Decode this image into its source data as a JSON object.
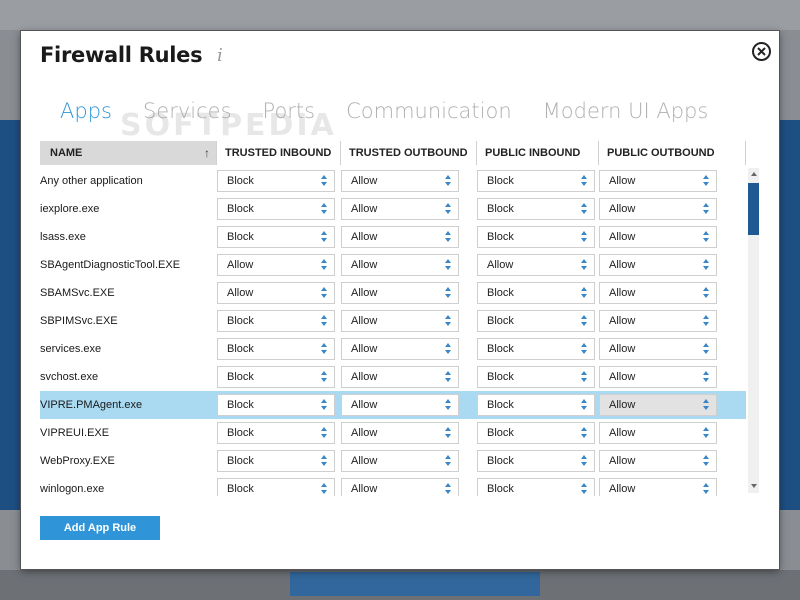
{
  "dialog": {
    "title": "Firewall Rules",
    "info_icon": "i"
  },
  "tabs": [
    {
      "label": "Apps",
      "active": true
    },
    {
      "label": "Services",
      "active": false
    },
    {
      "label": "Ports",
      "active": false
    },
    {
      "label": "Communication",
      "active": false
    },
    {
      "label": "Modern UI Apps",
      "active": false
    }
  ],
  "table": {
    "columns": [
      "NAME",
      "TRUSTED INBOUND",
      "TRUSTED OUTBOUND",
      "PUBLIC INBOUND",
      "PUBLIC OUTBOUND"
    ],
    "rows": [
      {
        "name": "Any other application",
        "values": [
          "Block",
          "Allow",
          "Block",
          "Allow"
        ]
      },
      {
        "name": "iexplore.exe",
        "values": [
          "Block",
          "Allow",
          "Block",
          "Allow"
        ]
      },
      {
        "name": "lsass.exe",
        "values": [
          "Block",
          "Allow",
          "Block",
          "Allow"
        ]
      },
      {
        "name": "SBAgentDiagnosticTool.EXE",
        "values": [
          "Allow",
          "Allow",
          "Allow",
          "Allow"
        ]
      },
      {
        "name": "SBAMSvc.EXE",
        "values": [
          "Allow",
          "Allow",
          "Block",
          "Allow"
        ]
      },
      {
        "name": "SBPIMSvc.EXE",
        "values": [
          "Block",
          "Allow",
          "Block",
          "Allow"
        ]
      },
      {
        "name": "services.exe",
        "values": [
          "Block",
          "Allow",
          "Block",
          "Allow"
        ]
      },
      {
        "name": "svchost.exe",
        "values": [
          "Block",
          "Allow",
          "Block",
          "Allow"
        ]
      },
      {
        "name": "VIPRE.PMAgent.exe",
        "values": [
          "Block",
          "Allow",
          "Block",
          "Allow"
        ]
      },
      {
        "name": "VIPREUI.EXE",
        "values": [
          "Block",
          "Allow",
          "Block",
          "Allow"
        ]
      },
      {
        "name": "WebProxy.EXE",
        "values": [
          "Block",
          "Allow",
          "Block",
          "Allow"
        ]
      },
      {
        "name": "winlogon.exe",
        "values": [
          "Block",
          "Allow",
          "Block",
          "Allow"
        ]
      }
    ],
    "selected_row": 8
  },
  "actions": {
    "add_app_rule": "Add App Rule"
  },
  "watermark": "SOFTPEDIA",
  "colors": {
    "accent": "#2f95d8",
    "selected_row": "#a9daf2",
    "scroll_thumb": "#1f5994"
  }
}
